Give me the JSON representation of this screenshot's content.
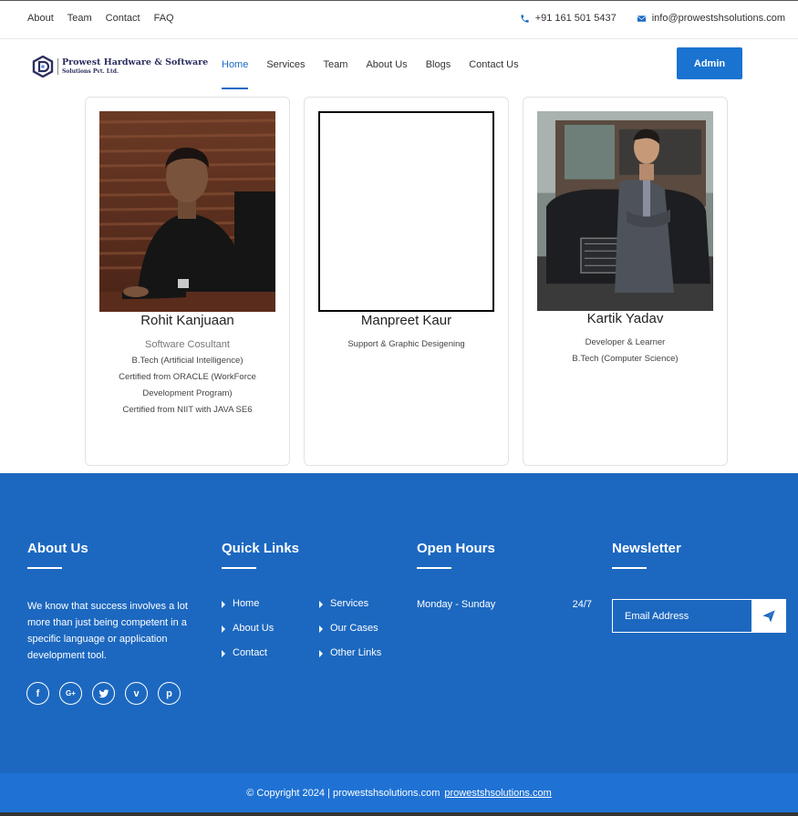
{
  "topbar": {
    "links": [
      "About",
      "Team",
      "Contact",
      "FAQ"
    ],
    "phone": "+91 161 501 5437",
    "email": "info@prowestshsolutions.com"
  },
  "navbar": {
    "logo_line1": "Prowest Hardware & Software",
    "logo_line2": "Solutions Pvt. Ltd.",
    "menu": [
      "Home",
      "Services",
      "Team",
      "About Us",
      "Blogs",
      "Contact Us"
    ],
    "active": "Home",
    "admin_label": "Admin"
  },
  "team": [
    {
      "name": "Rohit Kanjuaan",
      "role": "Software Cosultant",
      "details": [
        "B.Tech (Artificial Intelligence)",
        "Certified from ORACLE (WorkForce",
        "Development Program)",
        "Certified from NIIT with JAVA SE6"
      ]
    },
    {
      "name": "Manpreet Kaur",
      "role": "",
      "details": [
        "Support & Graphic Desigening"
      ]
    },
    {
      "name": "Kartik Yadav",
      "role": "",
      "details": [
        "Developer & Learner",
        "B.Tech (Computer Science)"
      ]
    }
  ],
  "footer": {
    "about": {
      "title": "About Us",
      "text": "We know that success involves a lot more than just being competent in a specific language or application development tool."
    },
    "quick_links": {
      "title": "Quick Links",
      "col1": [
        "Home",
        "About Us",
        "Contact"
      ],
      "col2": [
        "Services",
        "Our Cases",
        "Other Links"
      ]
    },
    "open_hours": {
      "title": "Open Hours",
      "days": "Monday - Sunday",
      "hours": "24/7"
    },
    "newsletter": {
      "title": "Newsletter",
      "placeholder": "Email Address"
    },
    "socials": [
      "facebook-icon",
      "google-plus-icon",
      "twitter-icon",
      "vimeo-icon",
      "pinterest-icon"
    ]
  },
  "copyright": {
    "text": "© Copyright 2024 | prowestshsolutions.com",
    "link": "prowestshsolutions.com"
  },
  "colors": {
    "primary": "#1a73d0",
    "footer_bg": "#1c68c0",
    "copyright_bg": "#1f72d4"
  }
}
